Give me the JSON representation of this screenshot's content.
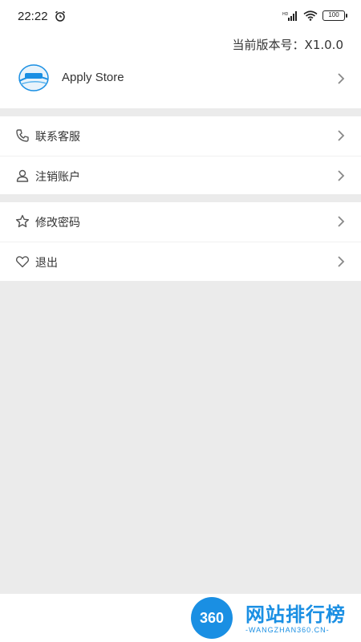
{
  "status": {
    "time": "22:22",
    "battery": "100"
  },
  "header": {
    "version_label": "当前版本号：X1.0.0"
  },
  "app": {
    "name": "Apply Store"
  },
  "menu_group_1": [
    {
      "label": "联系客服",
      "icon": "phone-icon"
    },
    {
      "label": "注销账户",
      "icon": "user-icon"
    }
  ],
  "menu_group_2": [
    {
      "label": "修改密码",
      "icon": "star-icon"
    },
    {
      "label": "退出",
      "icon": "heart-icon"
    }
  ],
  "watermark": {
    "logo_text": "360",
    "title": "网站排行榜",
    "subtitle": "-WANGZHAN360.CN-"
  },
  "colors": {
    "accent": "#1a8fe3",
    "background": "#ebebeb"
  }
}
